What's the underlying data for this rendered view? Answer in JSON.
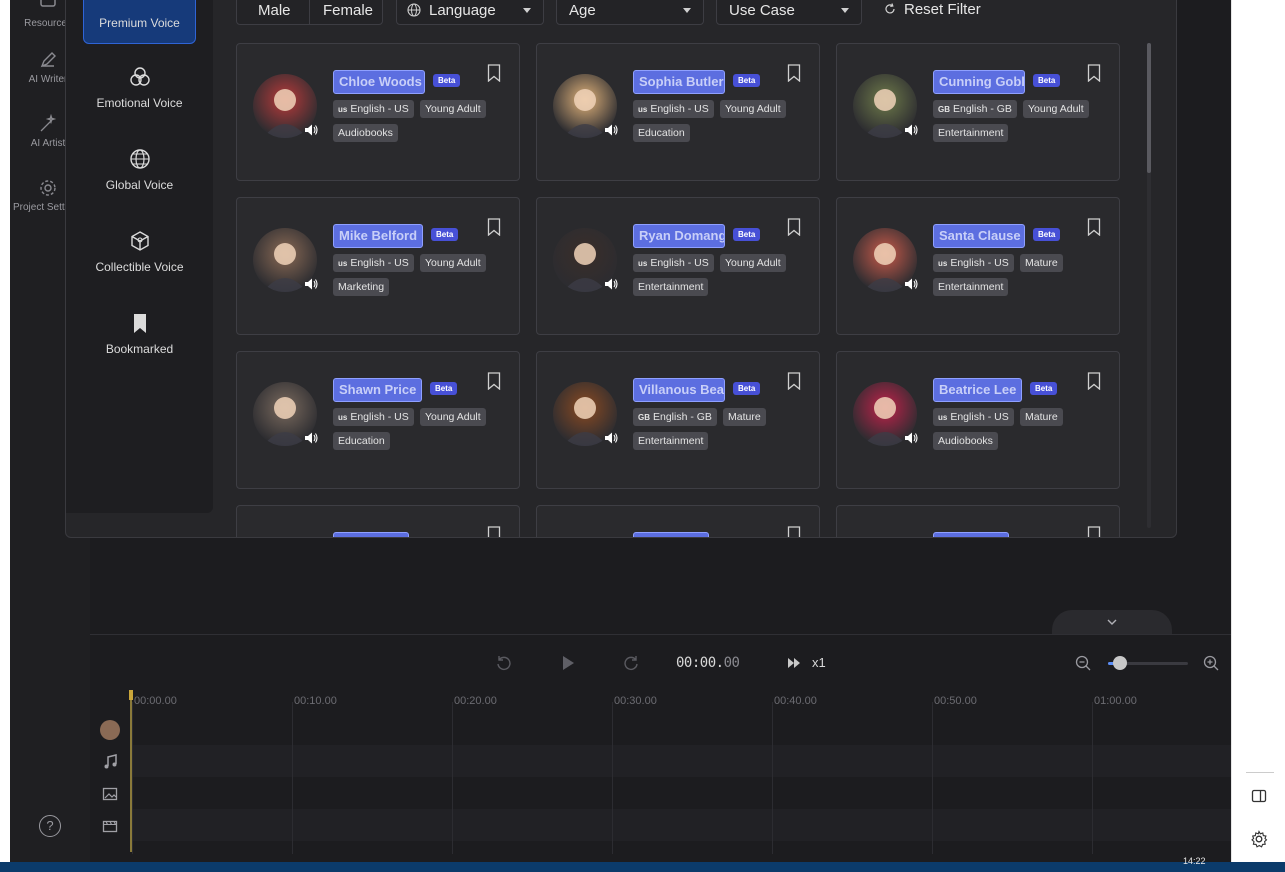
{
  "rail": {
    "items": [
      {
        "label": "Resources",
        "icon": "resources-icon"
      },
      {
        "label": "AI Writer",
        "icon": "pen-icon"
      },
      {
        "label": "AI Artist",
        "icon": "magic-wand-icon"
      },
      {
        "label": "Project Settings",
        "icon": "gear-icon"
      }
    ]
  },
  "categories": [
    {
      "label": "Premium Voice",
      "icon": "premium-icon",
      "active": true
    },
    {
      "label": "Emotional Voice",
      "icon": "emotion-icon",
      "active": false
    },
    {
      "label": "Global Voice",
      "icon": "globe-icon",
      "active": false
    },
    {
      "label": "Collectible Voice",
      "icon": "cube-icon",
      "active": false
    },
    {
      "label": "Bookmarked",
      "icon": "bookmark-icon",
      "active": false
    }
  ],
  "filters": {
    "male": "Male",
    "female": "Female",
    "language": "Language",
    "age": "Age",
    "use_case": "Use Case",
    "reset": "Reset Filter"
  },
  "voices": [
    {
      "name": "Chloe Woods",
      "beta": "Beta",
      "lang_code": "us",
      "lang": "English - US",
      "age": "Young Adult",
      "use": "Audiobooks",
      "avatar_color": "#b83a3a"
    },
    {
      "name": "Sophia Butler",
      "beta": "Beta",
      "lang_code": "us",
      "lang": "English - US",
      "age": "Young Adult",
      "use": "Education",
      "avatar_color": "#e0b27a"
    },
    {
      "name": "Cunning Goblin",
      "beta": "Beta",
      "lang_code": "GB",
      "lang": "English - GB",
      "age": "Young Adult",
      "use": "Entertainment",
      "avatar_color": "#6e7a4a"
    },
    {
      "name": "Mike Belford",
      "beta": "Beta",
      "lang_code": "us",
      "lang": "English - US",
      "age": "Young Adult",
      "use": "Marketing",
      "avatar_color": "#8a6a55"
    },
    {
      "name": "Ryan Domange",
      "beta": "Beta",
      "lang_code": "us",
      "lang": "English - US",
      "age": "Young Adult",
      "use": "Entertainment",
      "avatar_color": "#3a2e2a"
    },
    {
      "name": "Santa Clause",
      "beta": "Beta",
      "lang_code": "us",
      "lang": "English - US",
      "age": "Mature",
      "use": "Entertainment",
      "avatar_color": "#c85a4a"
    },
    {
      "name": "Shawn Price",
      "beta": "Beta",
      "lang_code": "us",
      "lang": "English - US",
      "age": "Young Adult",
      "use": "Education",
      "avatar_color": "#7a6a5e"
    },
    {
      "name": "Villanous Beast",
      "beta": "Beta",
      "lang_code": "GB",
      "lang": "English - GB",
      "age": "Mature",
      "use": "Entertainment",
      "avatar_color": "#8a4a22"
    },
    {
      "name": "Beatrice Lee",
      "beta": "Beta",
      "lang_code": "us",
      "lang": "English - US",
      "age": "Mature",
      "use": "Audiobooks",
      "avatar_color": "#c0224a"
    }
  ],
  "player": {
    "time_main": "00:00.",
    "time_frac": "00",
    "speed": "x1",
    "zoom_level": 0.15
  },
  "timeline": {
    "ticks": [
      "00:00.00",
      "00:10.00",
      "00:20.00",
      "00:30.00",
      "00:40.00",
      "00:50.00",
      "01:00.00"
    ]
  },
  "taskbar": {
    "clock": "14:22"
  }
}
